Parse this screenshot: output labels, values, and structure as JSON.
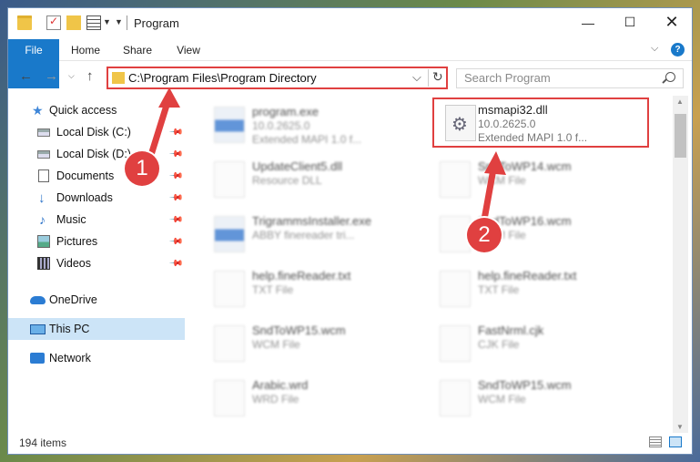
{
  "window": {
    "title": "Program"
  },
  "ribbon": {
    "tabs": [
      "File",
      "Home",
      "Share",
      "View"
    ],
    "help": "?"
  },
  "navbar": {
    "address": "C:\\Program Files\\Program Directory",
    "search_placeholder": "Search Program"
  },
  "sidebar": {
    "items": [
      {
        "label": "Quick access"
      },
      {
        "label": "Local Disk (C:)"
      },
      {
        "label": "Local Disk (D:)"
      },
      {
        "label": "Documents"
      },
      {
        "label": "Downloads"
      },
      {
        "label": "Music"
      },
      {
        "label": "Pictures"
      },
      {
        "label": "Videos"
      },
      {
        "label": "OneDrive"
      },
      {
        "label": "This PC"
      },
      {
        "label": "Network"
      }
    ]
  },
  "files": [
    {
      "name": "program.exe",
      "sub1": "10.0.2625.0",
      "sub2": "Extended MAPI 1.0 f..."
    },
    {
      "name": "msmapi32.dll",
      "sub1": "10.0.2625.0",
      "sub2": "Extended MAPI 1.0 f..."
    },
    {
      "name": "UpdateClient5.dll",
      "sub1": "Resource DLL",
      "sub2": ""
    },
    {
      "name": "SndToWP14.wcm",
      "sub1": "WCM File",
      "sub2": ""
    },
    {
      "name": "TrigrammsInstaller.exe",
      "sub1": "ABBY finereader tri...",
      "sub2": ""
    },
    {
      "name": "SndToWP16.wcm",
      "sub1": "WCM File",
      "sub2": ""
    },
    {
      "name": "help.fineReader.txt",
      "sub1": "TXT File",
      "sub2": ""
    },
    {
      "name": "help.fineReader.txt",
      "sub1": "TXT File",
      "sub2": ""
    },
    {
      "name": "SndToWP15.wcm",
      "sub1": "WCM File",
      "sub2": ""
    },
    {
      "name": "FastNrml.cjk",
      "sub1": "CJK File",
      "sub2": ""
    },
    {
      "name": "Arabic.wrd",
      "sub1": "WRD File",
      "sub2": ""
    },
    {
      "name": "SndToWP15.wcm",
      "sub1": "WCM File",
      "sub2": ""
    }
  ],
  "status": {
    "count": "194 items"
  },
  "annotations": {
    "one": "1",
    "two": "2",
    "color": "#e04040"
  }
}
